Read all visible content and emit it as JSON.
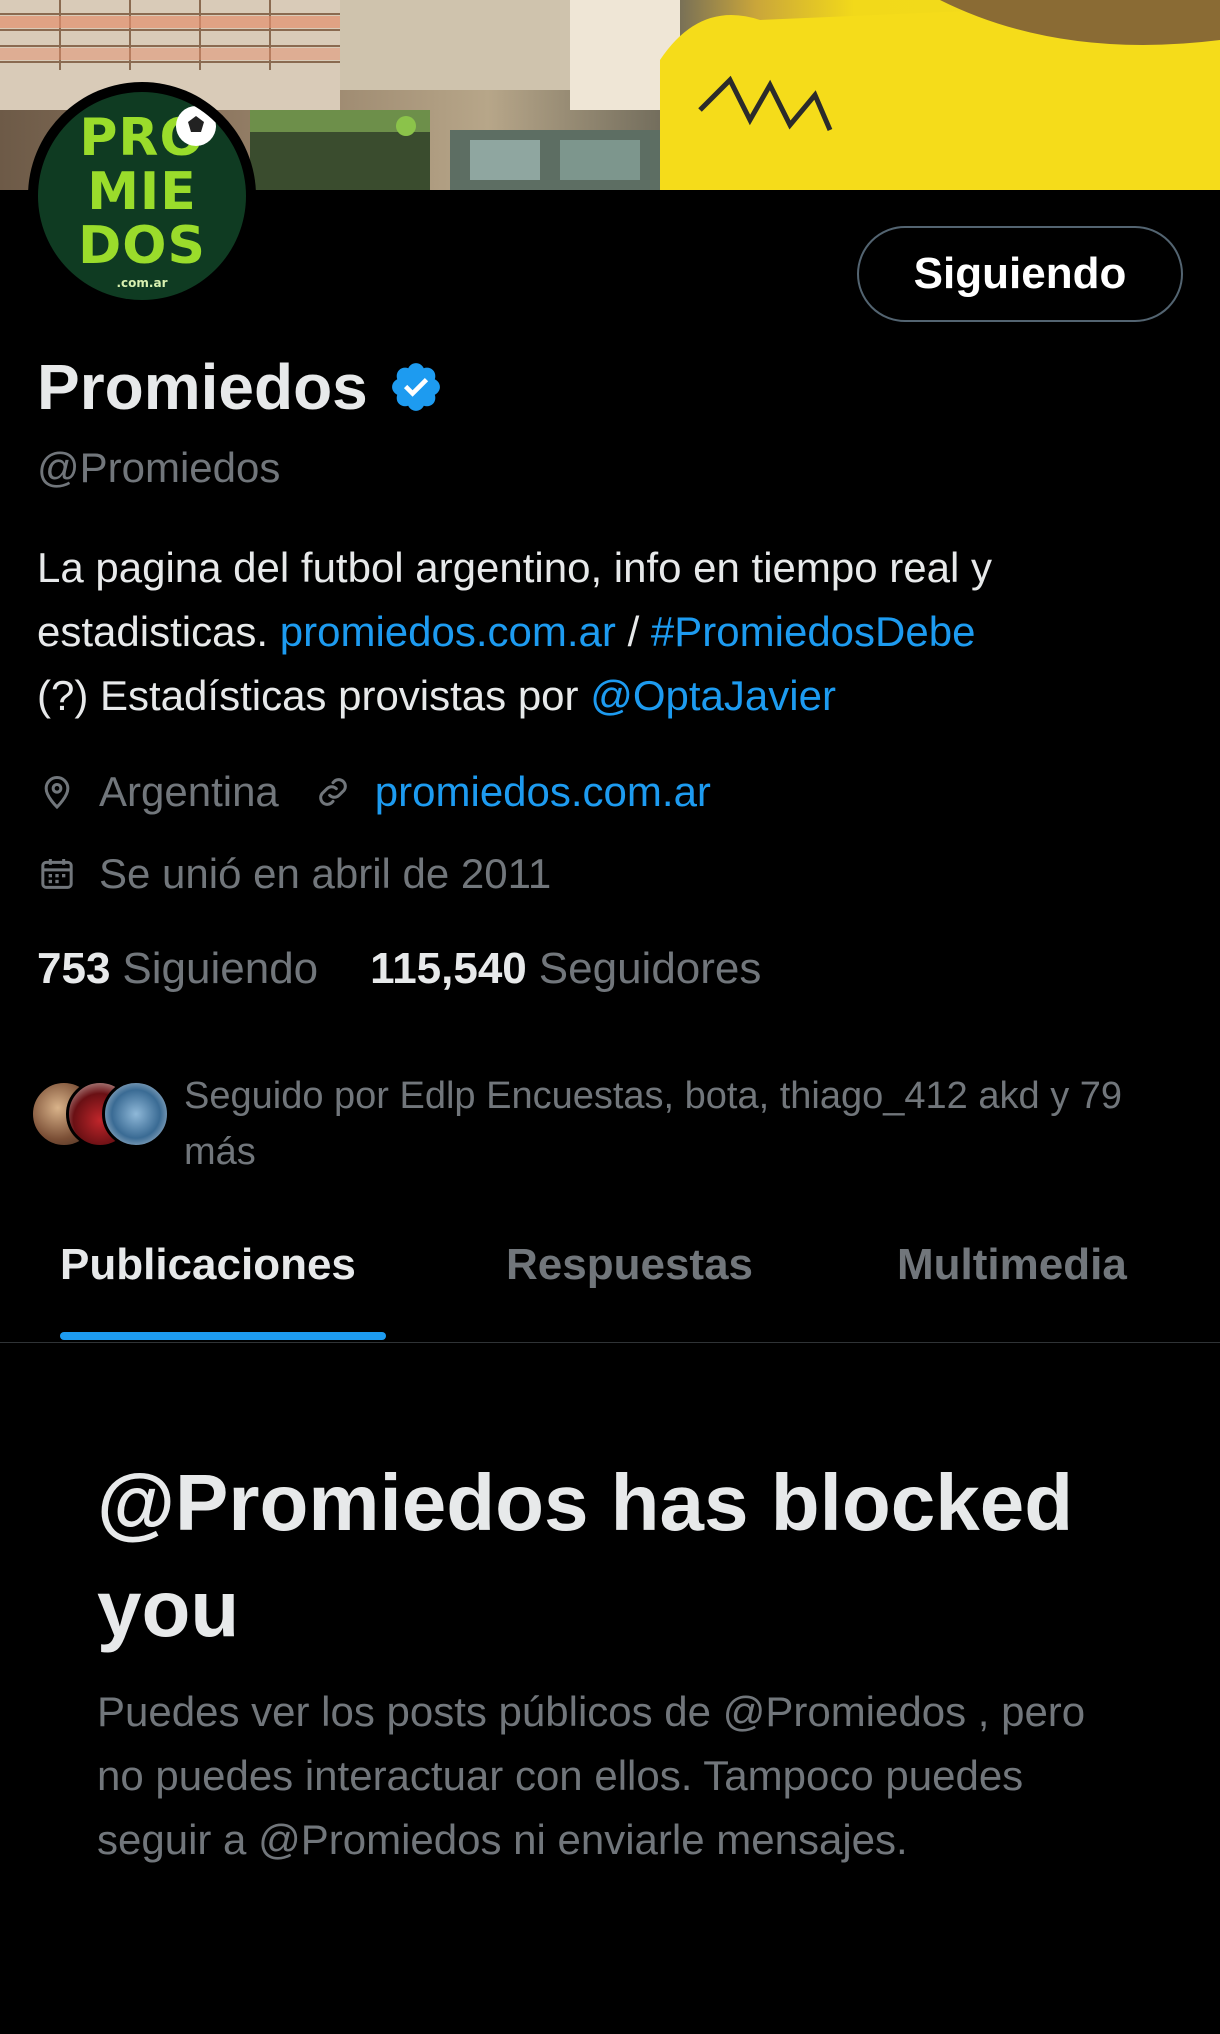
{
  "profile": {
    "display_name": "Promiedos",
    "handle": "@Promiedos",
    "follow_button_label": "Siguiendo",
    "avatar_logo_lines": [
      "PRO",
      "MIE",
      "DOS"
    ],
    "avatar_logo_domain": ".com.ar",
    "bio": {
      "line1": "La pagina del futbol argentino, info en tiempo real y",
      "line2_text": "estadisticas. ",
      "line2_link": "promiedos.com.ar",
      "line2_sep": " / ",
      "line2_hashtag": "#PromiedosDebe",
      "line3_text": "(?) Estadísticas provistas por ",
      "line3_mention": "@OptaJavier"
    },
    "location": "Argentina",
    "website": "promiedos.com.ar",
    "joined": "Se unió en abril de 2011",
    "following_count": "753",
    "following_label": "Siguiendo",
    "followers_count": "115,540",
    "followers_label": "Seguidores",
    "followed_by": "Seguido por Edlp Encuestas, bota, thiago_412 akd y 79 más"
  },
  "tabs": [
    {
      "label": "Publicaciones",
      "active": true
    },
    {
      "label": "Respuestas",
      "active": false
    },
    {
      "label": "Multimedia",
      "active": false
    }
  ],
  "blocked": {
    "title": "@Promiedos has blocked you",
    "description": "Puedes ver los posts públicos de @Promiedos , pero no puedes interactuar con ellos. Tampoco puedes seguir a @Promiedos ni enviarle mensajes."
  },
  "icons": [
    "location-icon",
    "link-icon",
    "calendar-icon",
    "verified-badge-icon"
  ],
  "colors": {
    "background": "#000000",
    "primary_text": "#e7e9ea",
    "secondary_text": "#71767b",
    "accent": "#1d9bf0",
    "verified": "#1d9bf0"
  }
}
